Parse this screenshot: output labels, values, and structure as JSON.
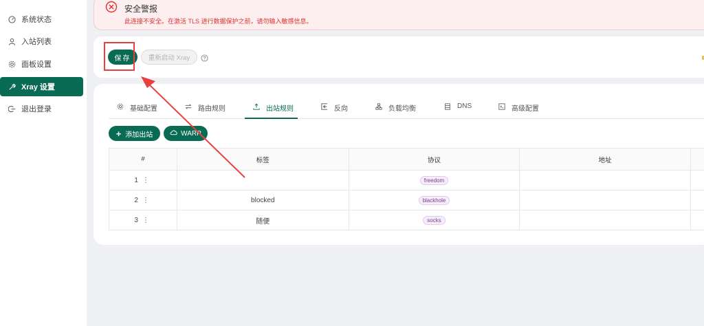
{
  "sidebar": {
    "items": [
      {
        "label": "系统状态",
        "icon": "dashboard-icon",
        "active": false
      },
      {
        "label": "入站列表",
        "icon": "user-icon",
        "active": false
      },
      {
        "label": "面板设置",
        "icon": "gear-icon",
        "active": false
      },
      {
        "label": "Xray 设置",
        "icon": "tool-icon",
        "active": true
      },
      {
        "label": "退出登录",
        "icon": "logout-icon",
        "active": false
      }
    ]
  },
  "alert": {
    "title": "安全警报",
    "message": "此连接不安全。在激活 TLS 进行数据保护之前，请勿输入敏感信息。",
    "icon": "close-circle-icon"
  },
  "toolbar": {
    "save_label": "保存",
    "restart_label": "重新启动 Xray",
    "help_icon": "question-circle-icon"
  },
  "tabs": [
    {
      "label": "基础配置",
      "icon": "gear-icon",
      "active": false
    },
    {
      "label": "路由规则",
      "icon": "swap-icon",
      "active": false
    },
    {
      "label": "出站规则",
      "icon": "upload-icon",
      "active": true
    },
    {
      "label": "反向",
      "icon": "import-icon",
      "active": false
    },
    {
      "label": "负载均衡",
      "icon": "cluster-icon",
      "active": false
    },
    {
      "label": "DNS",
      "icon": "database-icon",
      "active": false
    },
    {
      "label": "高级配置",
      "icon": "code-icon",
      "active": false
    }
  ],
  "actions": {
    "add_label": "添加出站",
    "warp_label": "WARP"
  },
  "table": {
    "headers": [
      "#",
      "标签",
      "协议",
      "地址"
    ],
    "rows": [
      {
        "index": "1",
        "tag": "",
        "protocol": "freedom",
        "address": ""
      },
      {
        "index": "2",
        "tag": "blocked",
        "protocol": "blackhole",
        "address": ""
      },
      {
        "index": "3",
        "tag": "随便",
        "protocol": "socks",
        "address": ""
      }
    ]
  },
  "colors": {
    "accent": "#0a6b55",
    "alert_bg": "#fdeff0",
    "alert_text": "#e0302a",
    "annotation": "#e8403e",
    "protocol_tag": "#7b3a8f"
  }
}
